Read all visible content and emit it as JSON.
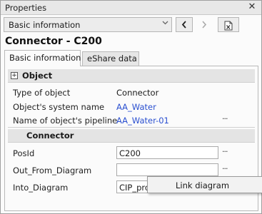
{
  "window": {
    "title": "Properties",
    "close_glyph": "✕"
  },
  "toolbar": {
    "view_selector": {
      "value": "Basic information",
      "icon": "chevron-down-icon"
    },
    "prev_icon": "chevron-left-icon",
    "next_icon": "chevron-right-icon",
    "export_icon": "excel-export-icon"
  },
  "heading": "Connector - C200",
  "tabs": [
    {
      "label": "Basic information",
      "active": true
    },
    {
      "label": "eShare data",
      "active": false
    }
  ],
  "sections": {
    "object": {
      "title": "Object",
      "expand_glyph": "+",
      "rows": [
        {
          "label": "Type of object",
          "value": "Connector"
        },
        {
          "label": "Object's system name",
          "value": "AA_Water"
        },
        {
          "label": "Name of object's pipeline",
          "value": "AA_Water-01",
          "more": "···"
        }
      ]
    },
    "connector": {
      "title": "Connector",
      "rows": [
        {
          "label": "PosId",
          "value": "C200",
          "more": "···"
        },
        {
          "label": "Out_From_Diagram",
          "value": "",
          "more": "···"
        },
        {
          "label": "Into_Diagram",
          "value": "CIP_pro"
        }
      ]
    }
  },
  "context_menu": {
    "items": [
      {
        "label": "Link diagram"
      }
    ]
  },
  "colors": {
    "link": "#2a4fd0",
    "section_bg": "#e4e4e4"
  }
}
